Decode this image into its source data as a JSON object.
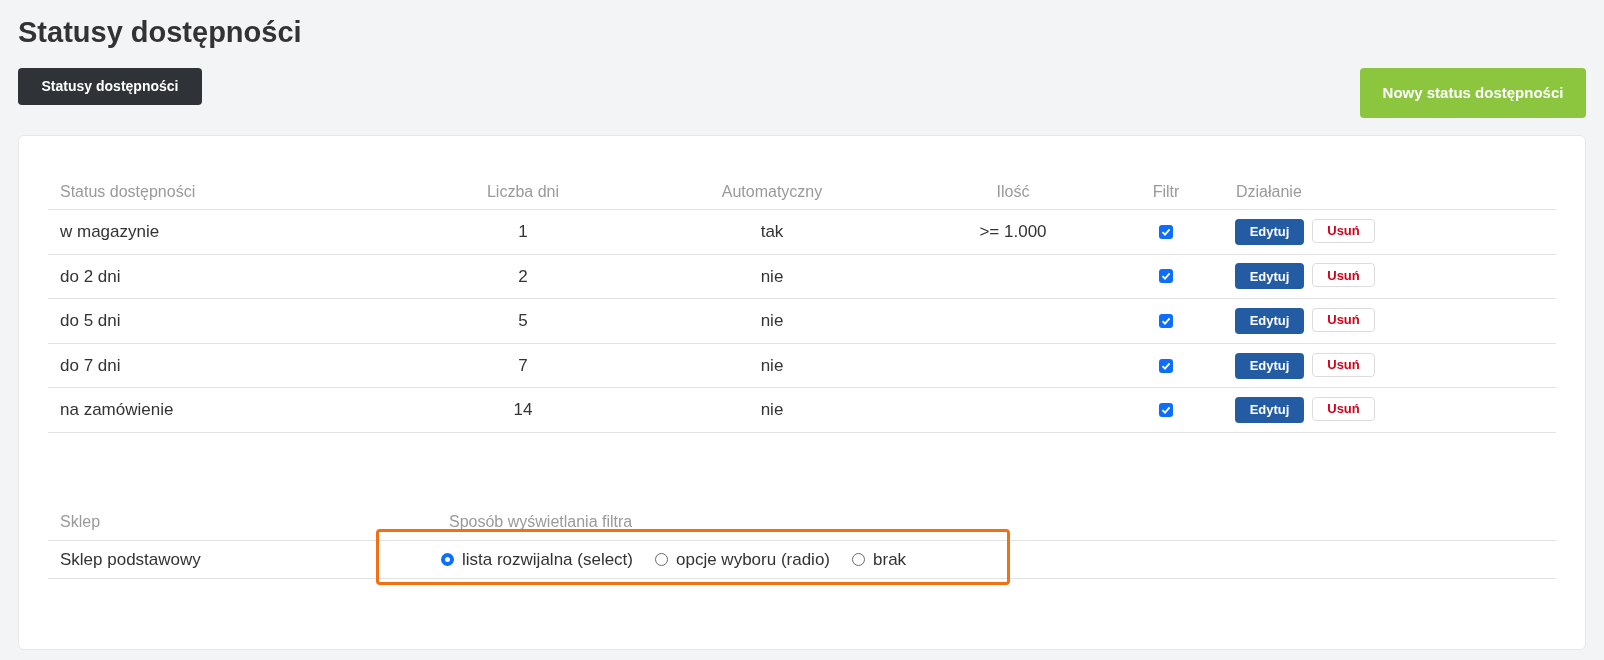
{
  "title": "Statusy dostępności",
  "tab_button": {
    "label": "Statusy dostępności"
  },
  "new_button": {
    "label": "Nowy status dostępności"
  },
  "table": {
    "columns": [
      "Status dostępności",
      "Liczba dni",
      "Automatyczny",
      "Ilość",
      "Filtr",
      "Działanie"
    ],
    "rows": [
      {
        "status": "w magazynie",
        "days": "1",
        "automatic": "tak",
        "quantity": ">= 1.000",
        "filter": true,
        "edit": "Edytuj",
        "delete": "Usuń"
      },
      {
        "status": "do 2 dni",
        "days": "2",
        "automatic": "nie",
        "filter": true,
        "edit": "Edytuj",
        "delete": "Usuń"
      },
      {
        "status": "do 5 dni",
        "days": "5",
        "automatic": "nie",
        "filter": true,
        "edit": "Edytuj",
        "delete": "Usuń"
      },
      {
        "status": "do 7 dni",
        "days": "7",
        "automatic": "nie",
        "filter": true,
        "edit": "Edytuj",
        "delete": "Usuń"
      },
      {
        "status": "na zamówienie",
        "days": "14",
        "automatic": "nie",
        "filter": true,
        "edit": "Edytuj",
        "delete": "Usuń"
      }
    ]
  },
  "shop_table": {
    "columns": [
      "Sklep",
      "Sposób wyświetlania filtra"
    ],
    "rows": [
      {
        "shop": "Sklep podstawowy",
        "highlighted": true,
        "options": [
          {
            "label": "lista rozwijalna (select)",
            "selected": true
          },
          {
            "label": "opcje wyboru (radio)",
            "selected": false
          },
          {
            "label": "brak",
            "selected": false
          }
        ]
      }
    ]
  }
}
